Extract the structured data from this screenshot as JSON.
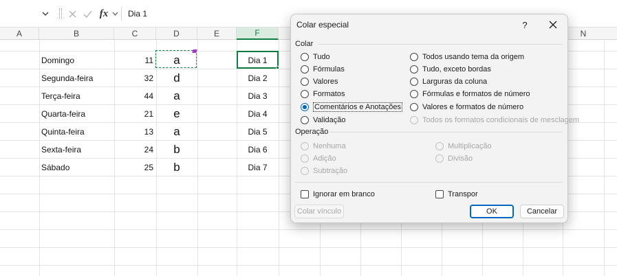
{
  "formula_bar": {
    "fx_label": "fx",
    "value": "Dia 1"
  },
  "columns": [
    "A",
    "B",
    "C",
    "D",
    "E",
    "F",
    "G",
    "N"
  ],
  "rows": [
    {
      "day": "Domingo",
      "num": "11",
      "letter": "a",
      "label": "Dia 1"
    },
    {
      "day": "Segunda-feira",
      "num": "32",
      "letter": "d",
      "label": "Dia 2"
    },
    {
      "day": "Terça-feira",
      "num": "44",
      "letter": "a",
      "label": "Dia 3"
    },
    {
      "day": "Quarta-feira",
      "num": "21",
      "letter": "e",
      "label": "Dia 4"
    },
    {
      "day": "Quinta-feira",
      "num": "13",
      "letter": "a",
      "label": "Dia 5"
    },
    {
      "day": "Sexta-feira",
      "num": "24",
      "letter": "b",
      "label": "Dia 6"
    },
    {
      "day": "Sábado",
      "num": "25",
      "letter": "b",
      "label": "Dia 7"
    }
  ],
  "dialog": {
    "title": "Colar especial",
    "help": "?",
    "paste_group": "Colar",
    "paste_left": [
      {
        "label": "Tudo",
        "selected": false
      },
      {
        "label": "Fórmulas",
        "selected": false
      },
      {
        "label": "Valores",
        "selected": false
      },
      {
        "label": "Formatos",
        "selected": false
      },
      {
        "label": "Comentários e Anotações",
        "selected": true
      },
      {
        "label": "Validação",
        "selected": false
      }
    ],
    "paste_right": [
      {
        "label": "Todos usando tema da origem",
        "disabled": false
      },
      {
        "label": "Tudo, exceto bordas",
        "disabled": false
      },
      {
        "label": "Larguras da coluna",
        "disabled": false
      },
      {
        "label": "Fórmulas e formatos de número",
        "disabled": false
      },
      {
        "label": "Valores e formatos de número",
        "disabled": false
      },
      {
        "label": "Todos os formatos condicionais de mesclagem",
        "disabled": true
      }
    ],
    "operation_group": "Operação",
    "operation_left": [
      {
        "label": "Nenhuma",
        "selected": true
      },
      {
        "label": "Adição",
        "selected": false
      },
      {
        "label": "Subtração",
        "selected": false
      }
    ],
    "operation_right": [
      {
        "label": "Multiplicação"
      },
      {
        "label": "Divisão"
      }
    ],
    "skip_blanks": "Ignorar em branco",
    "transpose": "Transpor",
    "paste_link": "Colar vínculo",
    "ok": "OK",
    "cancel": "Cancelar"
  }
}
